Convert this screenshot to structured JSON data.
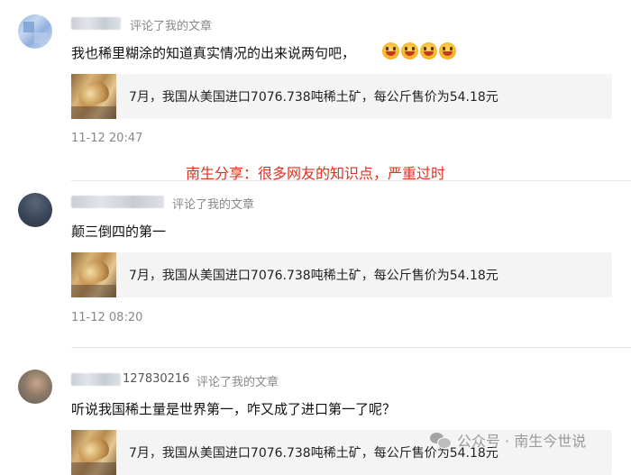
{
  "comments": [
    {
      "action": "评论了我的文章",
      "text": "我也稀里糊涂的知道真实情况的出来说两句吧，",
      "emoji_count": 4,
      "article_title": "7月，我国从美国进口7076.738吨稀土矿，每公斤售价为54.18元",
      "time": "11-12 20:47"
    },
    {
      "action": "评论了我的文章",
      "text": "颠三倒四的第一",
      "article_title": "7月，我国从美国进口7076.738吨稀土矿，每公斤售价为54.18元",
      "time": "11-12 08:20"
    },
    {
      "username_visible": "127830216",
      "action": "评论了我的文章",
      "text": "听说我国稀土量是世界第一，咋又成了进口第一了呢？",
      "article_title": "7月，我国从美国进口7076.738吨稀土矿，每公斤售价为54.18元"
    }
  ],
  "banner": "南生分享：很多网友的知识点，严重过时",
  "watermark": "公众号 · 南生今世说",
  "colors": {
    "banner": "#e0301e",
    "meta": "#888888",
    "article_bg": "#f4f4f5"
  }
}
